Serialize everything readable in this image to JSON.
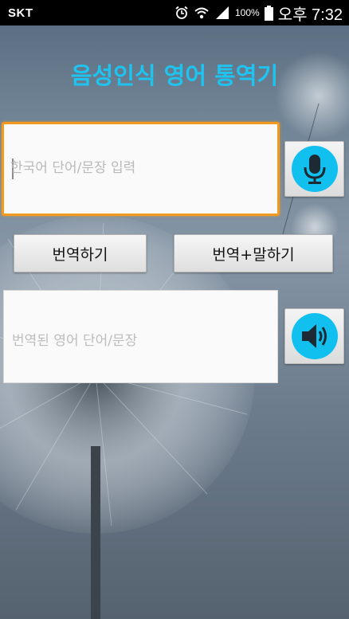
{
  "status_bar": {
    "carrier": "SKT",
    "battery_percent": "100%",
    "time": "오후 7:32",
    "icons": [
      "alarm-icon",
      "wifi-icon",
      "signal-icon",
      "battery-icon"
    ]
  },
  "app": {
    "title": "음성인식 영어 통역기"
  },
  "input": {
    "value": "",
    "placeholder": "한국어 단어/문장 입력"
  },
  "buttons": {
    "mic": "microphone-icon",
    "translate": "번역하기",
    "translate_speak": "번역+말하기",
    "speaker": "speaker-icon"
  },
  "output": {
    "placeholder": "번역된 영어 단어/문장"
  },
  "colors": {
    "accent": "#12c0ef",
    "title": "#1fc3f0",
    "focus_border": "#f29a1e"
  }
}
